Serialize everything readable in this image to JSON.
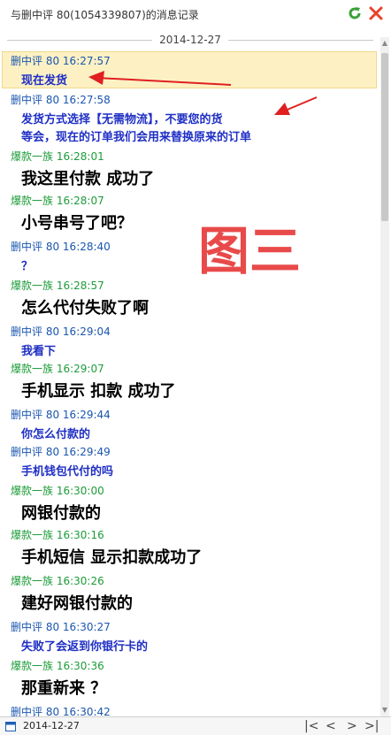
{
  "window": {
    "title": "与删中评 80(1054339807)的消息记录"
  },
  "date_separator": "2014-12-27",
  "watermark": "图三",
  "messages": [
    {
      "sender": "删中评 80",
      "time": "16:27:57",
      "text": "现在发货",
      "side": "seller"
    },
    {
      "sender": "删中评 80",
      "time": "16:27:58",
      "text": "发货方式选择【无需物流】，不要您的货",
      "text2": "等会，现在的订单我们会用来替换原来的订单",
      "side": "seller"
    },
    {
      "sender": "爆款一族",
      "time": "16:28:01",
      "text": "我这里付款 成功了",
      "side": "buyer"
    },
    {
      "sender": "爆款一族",
      "time": "16:28:07",
      "text": "小号串号了吧？",
      "side": "buyer"
    },
    {
      "sender": "删中评 80",
      "time": "16:28:40",
      "text": "？",
      "side": "seller"
    },
    {
      "sender": "爆款一族",
      "time": "16:28:57",
      "text": "怎么代付失败了啊",
      "side": "buyer"
    },
    {
      "sender": "删中评 80",
      "time": "16:29:04",
      "text": "我看下",
      "side": "seller"
    },
    {
      "sender": "爆款一族",
      "time": "16:29:07",
      "text": "手机显示 扣款 成功了",
      "side": "buyer"
    },
    {
      "sender": "删中评 80",
      "time": "16:29:44",
      "text": "你怎么付款的",
      "side": "seller"
    },
    {
      "sender": "删中评 80",
      "time": "16:29:49",
      "text": "手机钱包代付的吗",
      "side": "seller"
    },
    {
      "sender": "爆款一族",
      "time": "16:30:00",
      "text": "网银付款的",
      "side": "buyer"
    },
    {
      "sender": "爆款一族",
      "time": "16:30:16",
      "text": "手机短信 显示扣款成功了",
      "side": "buyer"
    },
    {
      "sender": "爆款一族",
      "time": "16:30:26",
      "text": "建好网银付款的",
      "side": "buyer"
    },
    {
      "sender": "删中评 80",
      "time": "16:30:27",
      "text": "失败了会返到你银行卡的",
      "side": "seller"
    },
    {
      "sender": "爆款一族",
      "time": "16:30:36",
      "text": "那重新来 ？",
      "side": "buyer"
    },
    {
      "sender": "删中评 80",
      "time": "16:30:42",
      "text": "",
      "side": "seller"
    }
  ],
  "bottom_bar": {
    "date": "2014-12-27"
  },
  "icons": [
    "refresh-icon",
    "close-icon",
    "calendar-icon",
    "first-page-icon",
    "prev-page-icon",
    "next-page-icon",
    "last-page-icon"
  ]
}
